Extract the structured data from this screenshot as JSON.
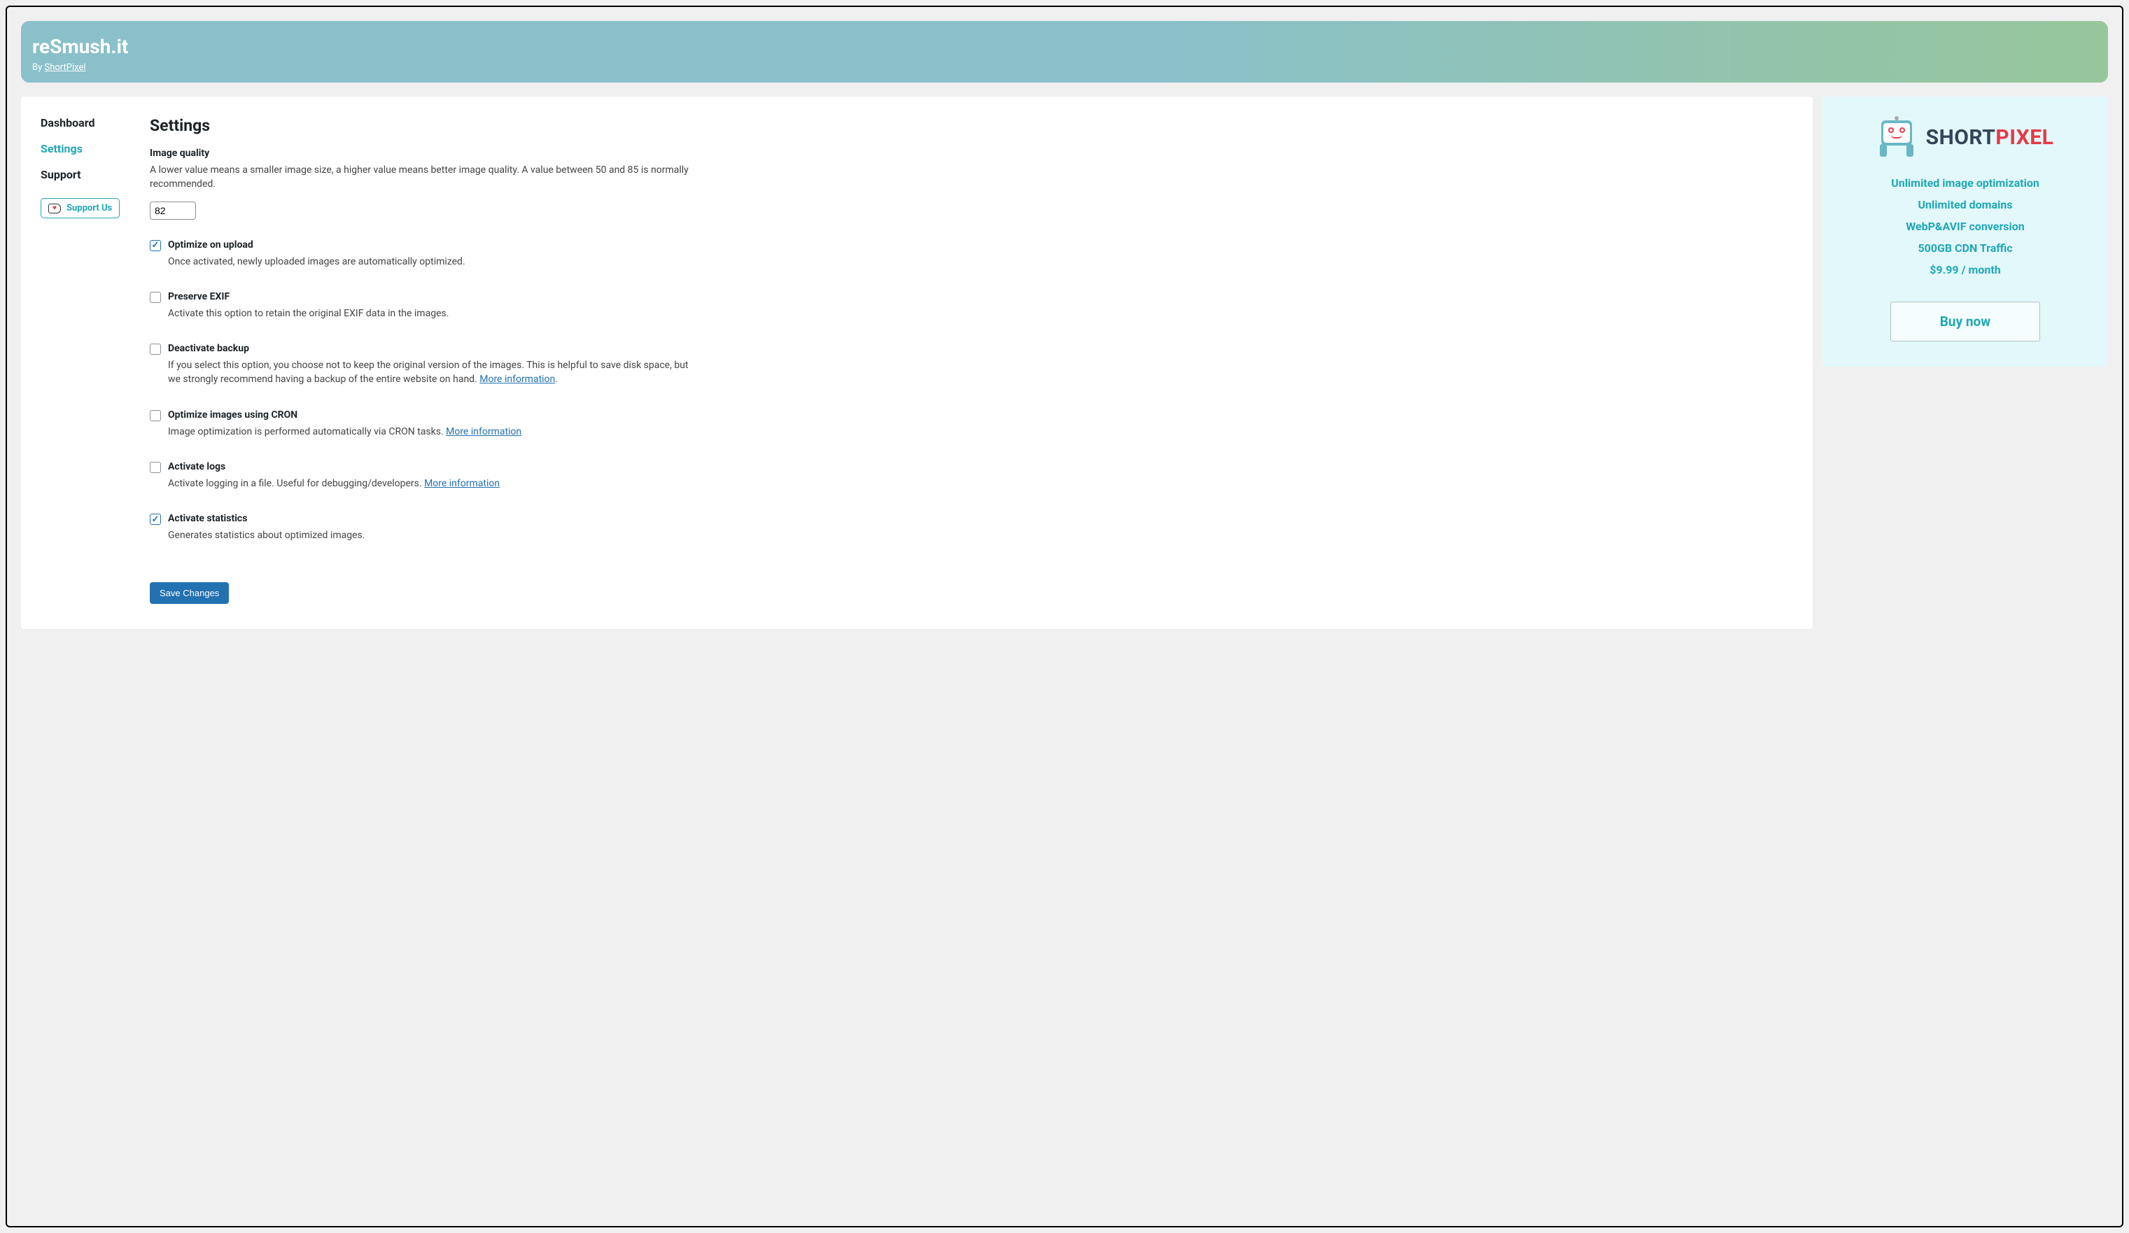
{
  "header": {
    "title": "reSmush.it",
    "byline_prefix": "By ",
    "byline_link": "ShortPixel"
  },
  "nav": {
    "items": [
      {
        "label": "Dashboard",
        "active": false
      },
      {
        "label": "Settings",
        "active": true
      },
      {
        "label": "Support",
        "active": false
      }
    ],
    "support_us": "Support Us"
  },
  "settings": {
    "page_title": "Settings",
    "image_quality": {
      "label": "Image quality",
      "desc": "A lower value means a smaller image size, a higher value means better image quality. A value between 50 and 85 is normally recommended.",
      "value": "82"
    },
    "options": [
      {
        "key": "optimize_upload",
        "checked": true,
        "title": "Optimize on upload",
        "desc": "Once activated, newly uploaded images are automatically optimized.",
        "link": null
      },
      {
        "key": "preserve_exif",
        "checked": false,
        "title": "Preserve EXIF",
        "desc": "Activate this option to retain the original EXIF data in the images.",
        "link": null
      },
      {
        "key": "deactivate_backup",
        "checked": false,
        "title": "Deactivate backup",
        "desc": "If you select this option, you choose not to keep the original version of the images. This is helpful to save disk space, but we strongly recommend having a backup of the entire website on hand. ",
        "link": "More information"
      },
      {
        "key": "cron",
        "checked": false,
        "title": "Optimize images using CRON",
        "desc": "Image optimization is performed automatically via CRON tasks. ",
        "link": "More information"
      },
      {
        "key": "logs",
        "checked": false,
        "title": "Activate logs",
        "desc": "Activate logging in a file. Useful for debugging/developers. ",
        "link": "More information"
      },
      {
        "key": "stats",
        "checked": true,
        "title": "Activate statistics",
        "desc": "Generates statistics about optimized images.",
        "link": null
      }
    ],
    "save_button": "Save Changes"
  },
  "promo": {
    "brand_part1": "SHORT",
    "brand_part2": "PIXEL",
    "features": [
      "Unlimited image optimization",
      "Unlimited domains",
      "WebP&AVIF conversion",
      "500GB CDN Traffic",
      "$9.99 / month"
    ],
    "buy_button": "Buy now"
  },
  "link_period": "."
}
